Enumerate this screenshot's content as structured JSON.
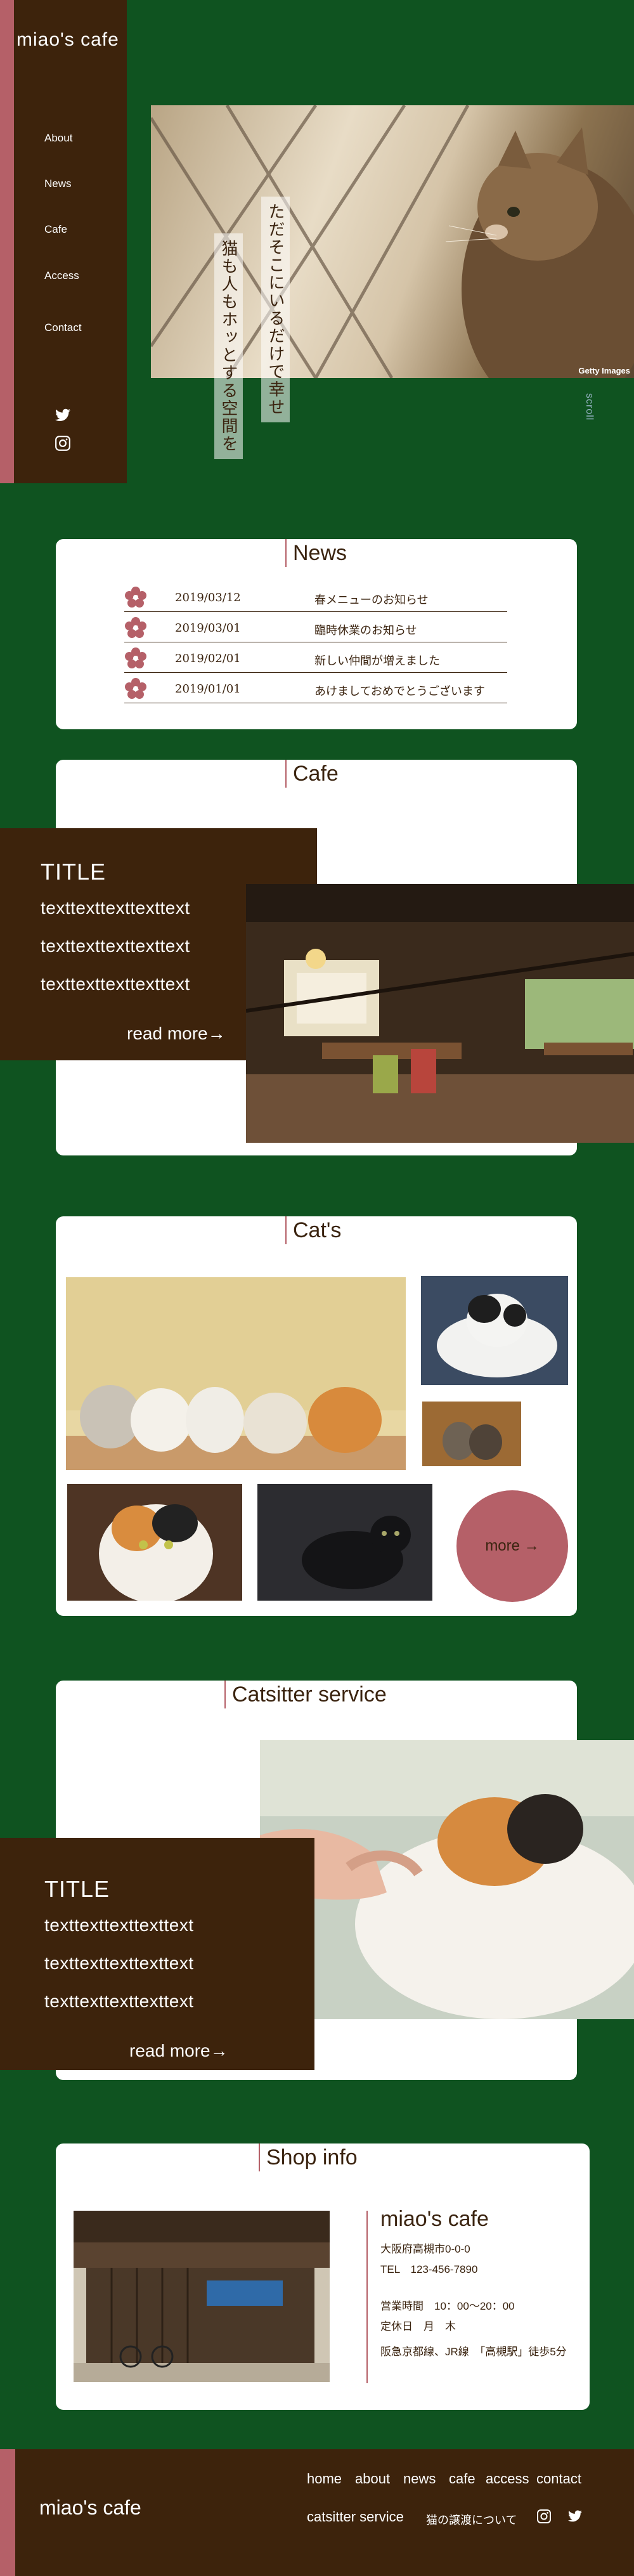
{
  "brand": "miao's cafe",
  "nav": [
    "About",
    "News",
    "Cafe",
    "Access",
    "Contact"
  ],
  "icons": {
    "twitter": "twitter-icon",
    "instagram": "instagram-icon"
  },
  "hero": {
    "caption_1": "ただそこにいるだけで幸せ",
    "caption_2": "猫も人もホッとする空間を",
    "credit": "Getty Images",
    "scroll": "scroll"
  },
  "news": {
    "title": "News",
    "items": [
      {
        "date": "2019/03/12",
        "text": "春メニューのお知らせ"
      },
      {
        "date": "2019/03/01",
        "text": "臨時休業のお知らせ"
      },
      {
        "date": "2019/02/01",
        "text": "新しい仲間が増えました"
      },
      {
        "date": "2019/01/01",
        "text": "あけましておめでとうございます"
      }
    ]
  },
  "cafe": {
    "title": "Cafe",
    "panel_title": "TITLE",
    "lines": [
      "texttexttexttexttext",
      "texttexttexttexttext",
      "texttexttexttexttext"
    ],
    "read_more": "read more→"
  },
  "cats": {
    "title": "Cat's",
    "more": "more →"
  },
  "catsitter": {
    "title": "Catsitter service",
    "panel_title": "TITLE",
    "lines": [
      "texttexttexttexttext",
      "texttexttexttexttext",
      "texttexttexttexttext"
    ],
    "read_more": "read more→"
  },
  "shop": {
    "title": "Shop info",
    "name": "miao's cafe",
    "address": "大阪府高槻市0-0-0",
    "tel": "TEL　123-456-7890",
    "hours": "営業時間　10：00〜20：00",
    "closed": "定休日　月　木",
    "access": "阪急京都線、JR線　「高槻駅」徒歩5分"
  },
  "footer": {
    "brand": "miao's cafe",
    "links": [
      "home",
      "about",
      "news",
      "cafe",
      "access",
      "contact"
    ],
    "catsitter": "catsitter service",
    "note": "猫の譲渡について"
  },
  "colors": {
    "background": "#0f5320",
    "brown": "#3d230c",
    "accent": "#b56068"
  }
}
